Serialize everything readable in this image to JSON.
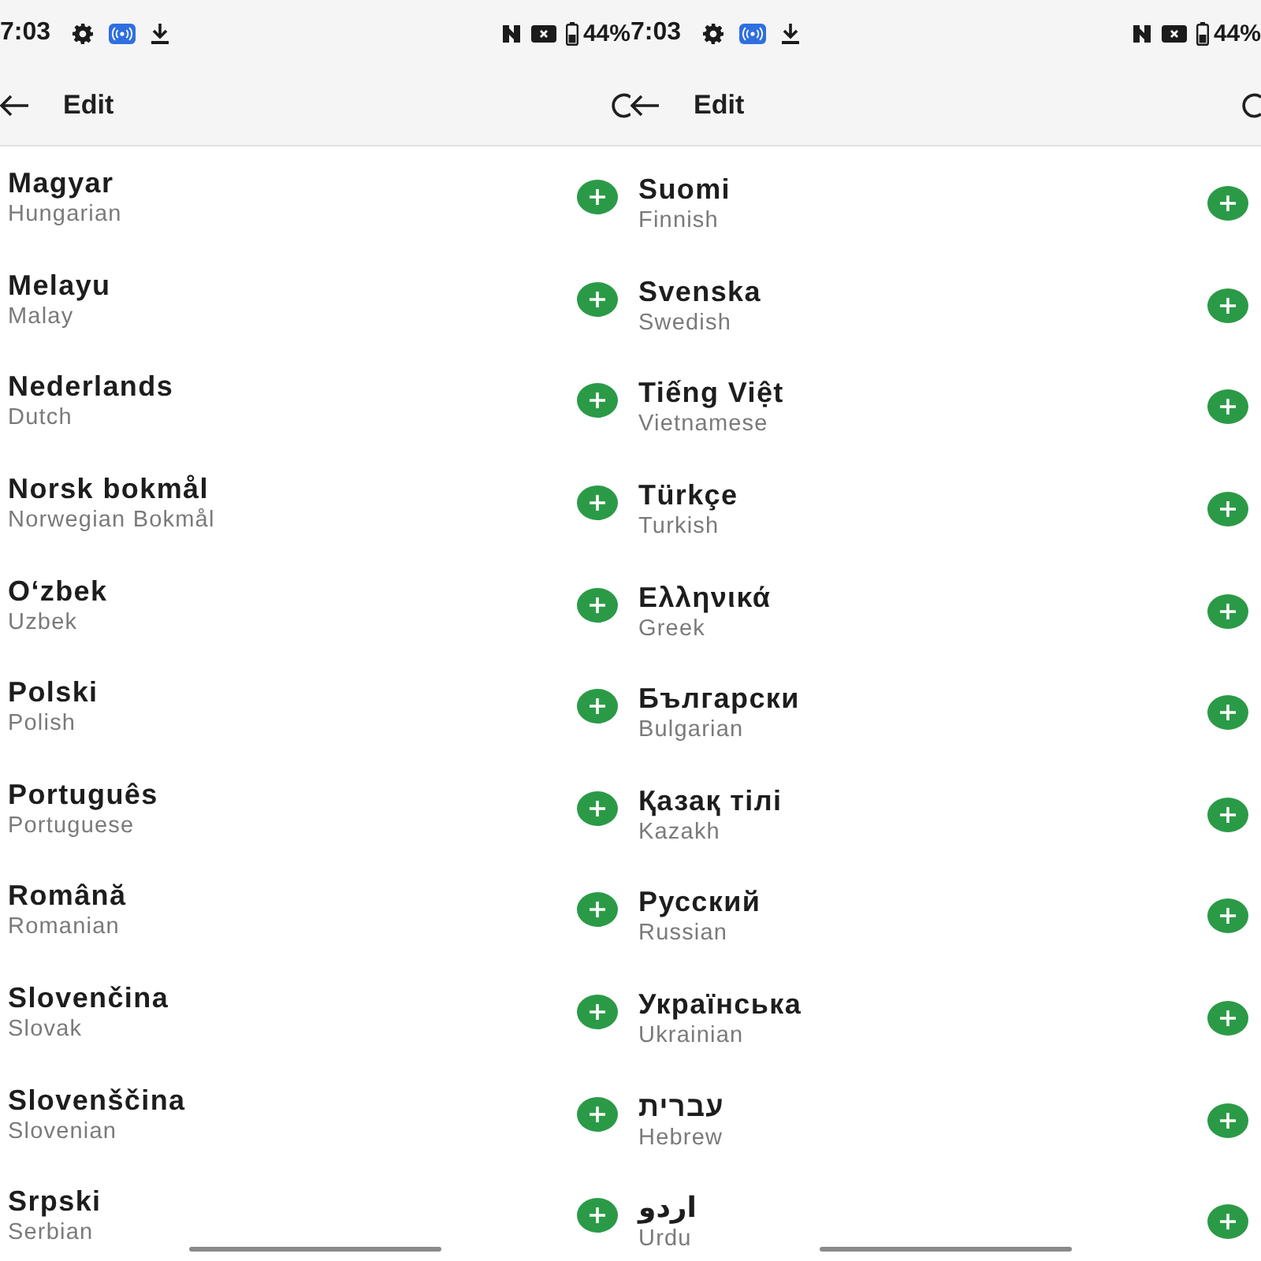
{
  "screens": [
    {
      "status_bar": {
        "time": "7:03",
        "battery": "44%"
      },
      "header": {
        "title": "Edit"
      },
      "languages": [
        {
          "name": "Magyar",
          "english": "Hungarian"
        },
        {
          "name": "Melayu",
          "english": "Malay"
        },
        {
          "name": "Nederlands",
          "english": "Dutch"
        },
        {
          "name": "Norsk bokmål",
          "english": "Norwegian Bokmål"
        },
        {
          "name": "Oʻzbek",
          "english": "Uzbek"
        },
        {
          "name": "Polski",
          "english": "Polish"
        },
        {
          "name": "Português",
          "english": "Portuguese"
        },
        {
          "name": "Română",
          "english": "Romanian"
        },
        {
          "name": "Slovenčina",
          "english": "Slovak"
        },
        {
          "name": "Slovenščina",
          "english": "Slovenian"
        },
        {
          "name": "Srpski",
          "english": "Serbian"
        }
      ]
    },
    {
      "status_bar": {
        "time": "7:03",
        "battery": "44%"
      },
      "header": {
        "title": "Edit"
      },
      "languages": [
        {
          "name": "Suomi",
          "english": "Finnish"
        },
        {
          "name": "Svenska",
          "english": "Swedish"
        },
        {
          "name": "Tiếng Việt",
          "english": "Vietnamese"
        },
        {
          "name": "Türkçe",
          "english": "Turkish"
        },
        {
          "name": "Ελληνικά",
          "english": "Greek"
        },
        {
          "name": "Български",
          "english": "Bulgarian"
        },
        {
          "name": "Қазақ тілі",
          "english": "Kazakh"
        },
        {
          "name": "Русский",
          "english": "Russian"
        },
        {
          "name": "Українська",
          "english": "Ukrainian"
        },
        {
          "name": "עברית",
          "english": "Hebrew"
        },
        {
          "name": "اردو",
          "english": "Urdu"
        }
      ]
    }
  ]
}
